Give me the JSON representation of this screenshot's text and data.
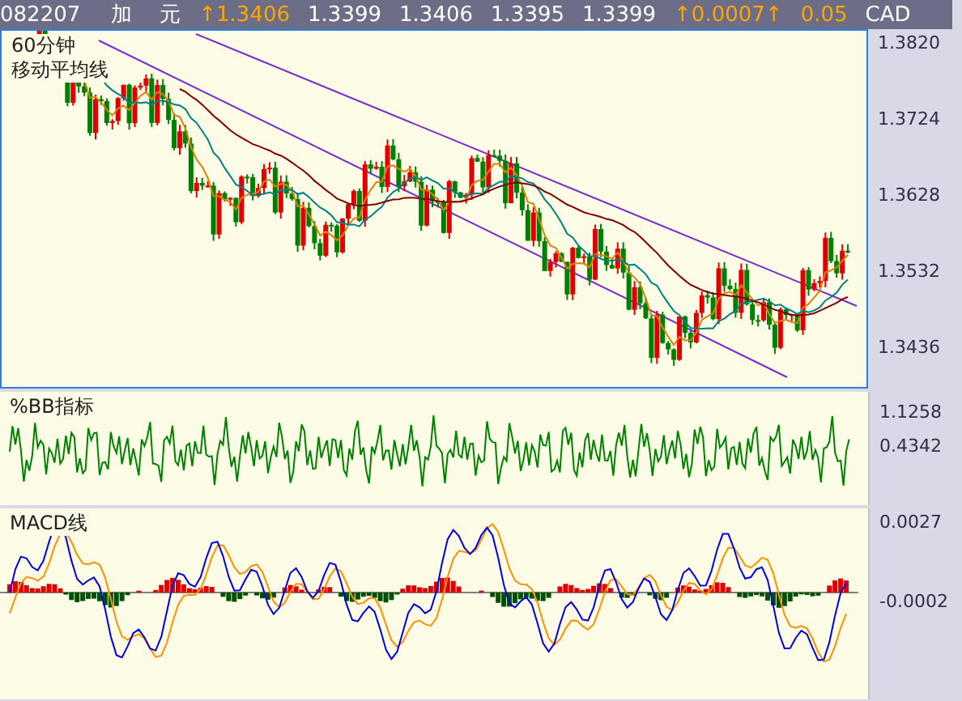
{
  "quote_bar": {
    "fields": [
      {
        "text": "082207",
        "color": "#ffffff"
      },
      {
        "text": "加",
        "color": "#ffffff"
      },
      {
        "text": "元",
        "color": "#ffffff"
      },
      {
        "text": "↑1.3406",
        "color": "#ffa500"
      },
      {
        "text": "1.3399",
        "color": "#ffffff"
      },
      {
        "text": "1.3406",
        "color": "#ffffff"
      },
      {
        "text": "1.3395",
        "color": "#ffffff"
      },
      {
        "text": "1.3399",
        "color": "#ffffff"
      },
      {
        "text": "↑0.0007↑",
        "color": "#ffa500"
      },
      {
        "text": "0.05",
        "color": "#ffa500"
      },
      {
        "text": "CAD",
        "color": "#ffffff"
      }
    ]
  },
  "panels": [
    {
      "kind": "price",
      "labels": [
        "60分钟",
        "移动平均线"
      ],
      "axis_labels": [
        "1.3820",
        "1.3724",
        "1.3628",
        "1.3532",
        "1.3436"
      ]
    },
    {
      "kind": "oscillator",
      "labels": [
        "%BB指标"
      ],
      "axis_labels": [
        "1.1258",
        "0.4342"
      ]
    },
    {
      "kind": "macd",
      "labels": [
        "MACD线"
      ],
      "axis_labels": [
        "0.0027",
        "-0.0002"
      ]
    }
  ]
}
